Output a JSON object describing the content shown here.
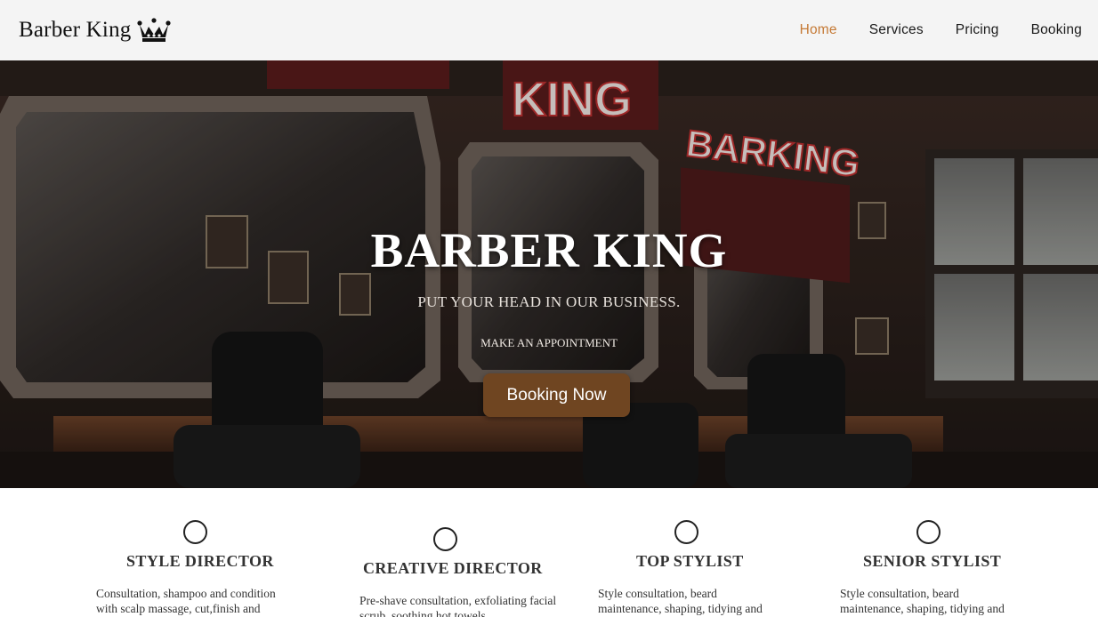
{
  "header": {
    "brand_name": "Barber King",
    "brand_icon": "crown-icon",
    "nav": [
      {
        "label": "Home",
        "active": true
      },
      {
        "label": "Services",
        "active": false
      },
      {
        "label": "Pricing",
        "active": false
      },
      {
        "label": "Booking",
        "active": false
      }
    ]
  },
  "hero": {
    "background": "barbershop-interior-photo",
    "title": "BARBER KING",
    "tagline": "PUT YOUR HEAD IN OUR BUSINESS.",
    "cta_label": "MAKE AN APPOINTMENT",
    "button_label": "Booking Now"
  },
  "staff": [
    {
      "icon": "circle-icon",
      "role": "STYLE DIRECTOR",
      "description": "Consultation, shampoo and condition with scalp massage, cut,finish and"
    },
    {
      "icon": "circle-icon",
      "role": "CREATIVE DIRECTOR",
      "description": "Pre-shave consultation, exfoliating facial scrub, soothing hot towels"
    },
    {
      "icon": "circle-icon",
      "role": "TOP STYLIST",
      "description": "Style consultation, beard maintenance, shaping, tidying and"
    },
    {
      "icon": "circle-icon",
      "role": "SENIOR STYLIST",
      "description": "Style consultation, beard maintenance, shaping, tidying and"
    }
  ],
  "colors": {
    "accent": "#c57a36",
    "button": "#6f4521",
    "header_bg": "#f4f4f4"
  }
}
